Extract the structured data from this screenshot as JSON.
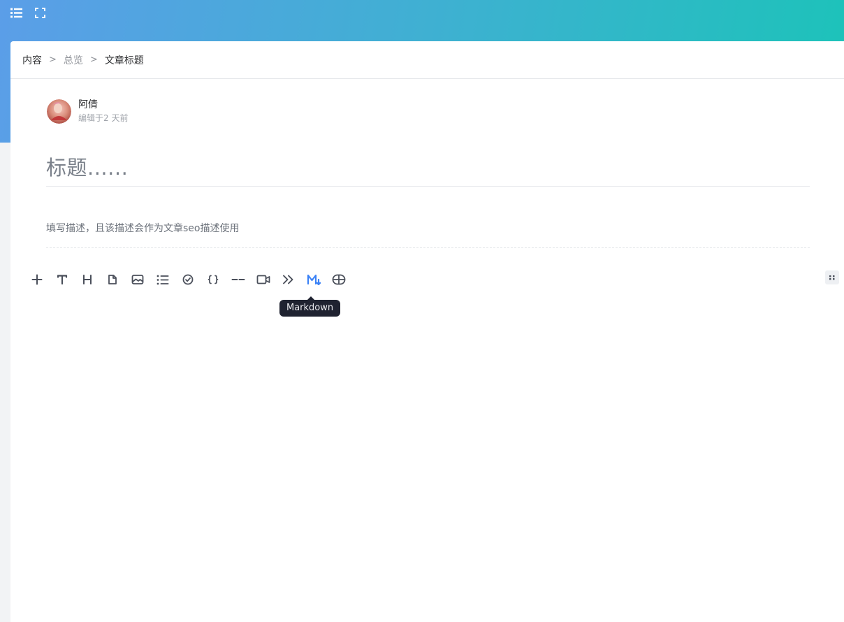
{
  "header": {
    "menu_icon": "list-menu-icon",
    "fullscreen_icon": "fullscreen-icon",
    "accent_gradient": [
      "#5b9ee8",
      "#1cc3b9"
    ]
  },
  "breadcrumb": {
    "items": [
      "内容",
      "总览",
      "文章标题"
    ],
    "separator": ">"
  },
  "author": {
    "name": "阿倩",
    "meta": "编辑于2 天前"
  },
  "editor": {
    "title_placeholder": "标题......",
    "description_placeholder": "填写描述，且该描述会作为文章seo描述使用"
  },
  "toolbar": {
    "tools": [
      {
        "icon": "plus-icon"
      },
      {
        "icon": "text-icon"
      },
      {
        "icon": "heading-icon"
      },
      {
        "icon": "file-icon"
      },
      {
        "icon": "image-icon"
      },
      {
        "icon": "list-icon"
      },
      {
        "icon": "checklist-icon"
      },
      {
        "icon": "code-braces-icon"
      },
      {
        "icon": "divider-icon"
      },
      {
        "icon": "video-icon"
      },
      {
        "icon": "quote-icon"
      },
      {
        "icon": "markdown-icon",
        "active": true
      },
      {
        "icon": "table-icon"
      }
    ],
    "active_color": "#3b82f6",
    "icon_color": "#4a4f5a"
  },
  "tooltip": {
    "text": "Markdown"
  }
}
